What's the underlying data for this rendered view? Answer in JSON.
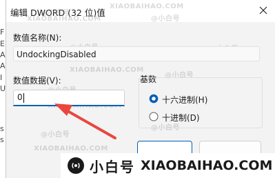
{
  "background_window": {
    "edge_letters": [
      "F",
      "E",
      "A",
      "A",
      "I",
      "U",
      "s",
      "s"
    ]
  },
  "dialog": {
    "title": "编辑 DWORD (32 位)值",
    "name_label": "数值名称(N):",
    "name_value": "UndockingDisabled",
    "data_label": "数值数据(V):",
    "data_value": "0",
    "base_label": "基数",
    "base_options": [
      {
        "label": "十六进制(H)",
        "selected": true
      },
      {
        "label": "十进制(D)",
        "selected": false
      }
    ]
  },
  "watermark": {
    "handle": "@小白号",
    "site": "XIAOBAIHAO.COM"
  },
  "banner": {
    "brand_cn": "小白号",
    "brand_en": "XIAOBAIHAO.COM"
  },
  "colors": {
    "accent": "#005fb8",
    "arrow": "#e8473f"
  }
}
